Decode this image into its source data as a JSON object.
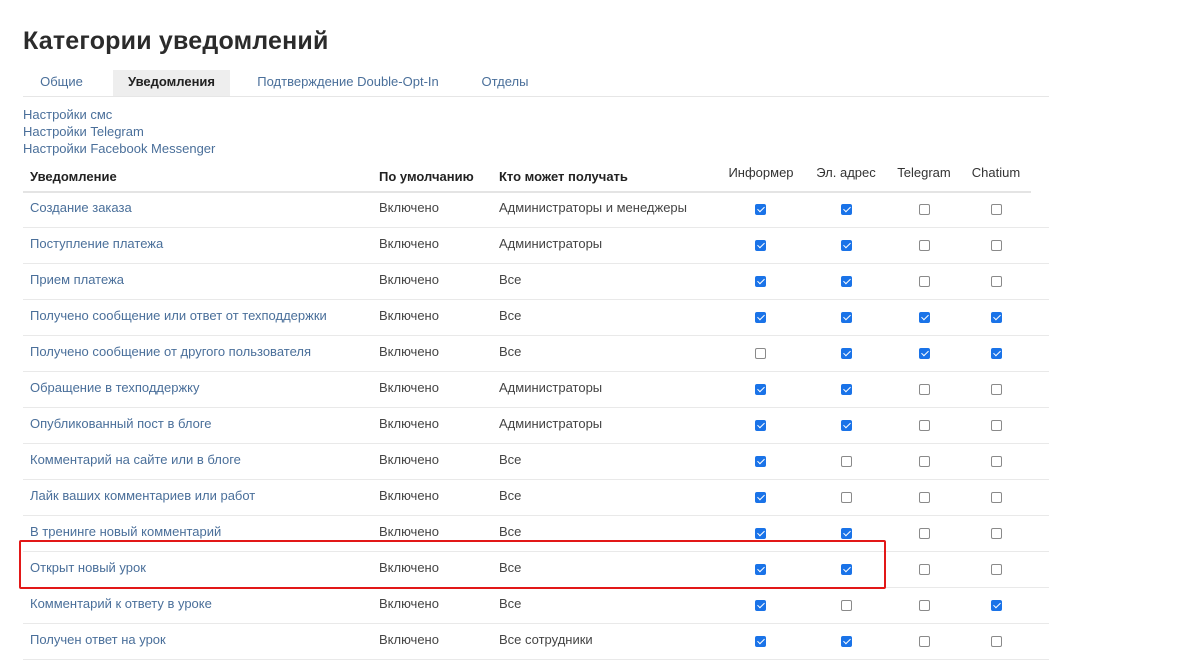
{
  "page": {
    "title": "Категории уведомлений"
  },
  "tabs": [
    {
      "label": "Общие",
      "active": false
    },
    {
      "label": "Уведомления",
      "active": true
    },
    {
      "label": "Подтверждение Double-Opt-In",
      "active": false
    },
    {
      "label": "Отделы",
      "active": false
    }
  ],
  "settings_links": [
    {
      "label": "Настройки смс"
    },
    {
      "label": "Настройки Telegram"
    },
    {
      "label": "Настройки Facebook Messenger"
    }
  ],
  "table": {
    "headers": {
      "notification": "Уведомление",
      "default": "По умолчанию",
      "recipients": "Кто может получать",
      "informer": "Информер",
      "email": "Эл. адрес",
      "telegram": "Telegram",
      "chatium": "Chatium"
    },
    "rows": [
      {
        "name": "Создание заказа",
        "default": "Включено",
        "who": "Администраторы и менеджеры",
        "informer": true,
        "email": true,
        "telegram": false,
        "chatium": false
      },
      {
        "name": "Поступление платежа",
        "default": "Включено",
        "who": "Администраторы",
        "informer": true,
        "email": true,
        "telegram": false,
        "chatium": false
      },
      {
        "name": "Прием платежа",
        "default": "Включено",
        "who": "Все",
        "informer": true,
        "email": true,
        "telegram": false,
        "chatium": false
      },
      {
        "name": "Получено сообщение или ответ от техподдержки",
        "default": "Включено",
        "who": "Все",
        "informer": true,
        "email": true,
        "telegram": true,
        "chatium": true
      },
      {
        "name": "Получено сообщение от другого пользователя",
        "default": "Включено",
        "who": "Все",
        "informer": false,
        "email": true,
        "telegram": true,
        "chatium": true
      },
      {
        "name": "Обращение в техподдержку",
        "default": "Включено",
        "who": "Администраторы",
        "informer": true,
        "email": true,
        "telegram": false,
        "chatium": false
      },
      {
        "name": "Опубликованный пост в блоге",
        "default": "Включено",
        "who": "Администраторы",
        "informer": true,
        "email": true,
        "telegram": false,
        "chatium": false
      },
      {
        "name": "Комментарий на сайте или в блоге",
        "default": "Включено",
        "who": "Все",
        "informer": true,
        "email": false,
        "telegram": false,
        "chatium": false
      },
      {
        "name": "Лайк ваших комментариев или работ",
        "default": "Включено",
        "who": "Все",
        "informer": true,
        "email": false,
        "telegram": false,
        "chatium": false
      },
      {
        "name": "В тренинге новый комментарий",
        "default": "Включено",
        "who": "Все",
        "informer": true,
        "email": true,
        "telegram": false,
        "chatium": false
      },
      {
        "name": "Открыт новый урок",
        "default": "Включено",
        "who": "Все",
        "informer": true,
        "email": true,
        "telegram": false,
        "chatium": false
      },
      {
        "name": "Комментарий к ответу в уроке",
        "default": "Включено",
        "who": "Все",
        "informer": true,
        "email": false,
        "telegram": false,
        "chatium": true
      },
      {
        "name": "Получен ответ на урок",
        "default": "Включено",
        "who": "Все сотрудники",
        "informer": true,
        "email": true,
        "telegram": false,
        "chatium": false
      }
    ]
  },
  "highlight": {
    "row_index": 10,
    "color": "#e21818"
  },
  "colors": {
    "link": "#4a6f9a",
    "checkbox_on": "#1a73e8",
    "active_tab_bg": "#eeeeee"
  }
}
